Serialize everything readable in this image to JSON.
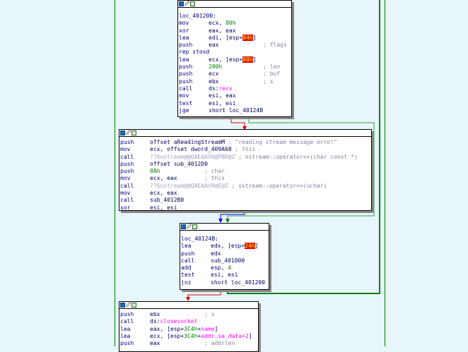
{
  "blocks": {
    "b1": {
      "label": "loc_401200:",
      "lines": [
        {
          "op": "mov",
          "args": [
            {
              "t": "ecx, "
            },
            {
              "t": "80h",
              "c": "n"
            }
          ]
        },
        {
          "op": "xor",
          "args": [
            {
              "t": "eax, eax"
            }
          ]
        },
        {
          "op": "lea",
          "args": [
            {
              "t": "edi, [esp+"
            },
            {
              "t": "84h",
              "c": "hl"
            },
            {
              "t": "]"
            }
          ]
        },
        {
          "op": "push",
          "args": [
            {
              "t": "eax             "
            },
            {
              "t": "; flags",
              "c": "cm"
            }
          ]
        },
        {
          "op": "rep stosd",
          "args": []
        },
        {
          "op": "lea",
          "args": [
            {
              "t": "ecx, [esp+"
            },
            {
              "t": "88h",
              "c": "hl"
            },
            {
              "t": "]"
            }
          ]
        },
        {
          "op": "push",
          "args": [
            {
              "t": "200h",
              "c": "n"
            },
            {
              "t": "            "
            },
            {
              "t": "; len",
              "c": "cm"
            }
          ]
        },
        {
          "op": "push",
          "args": [
            {
              "t": "ecx             "
            },
            {
              "t": "; buf",
              "c": "cm"
            }
          ]
        },
        {
          "op": "push",
          "args": [
            {
              "t": "ebx             "
            },
            {
              "t": "; s",
              "c": "cm"
            }
          ]
        },
        {
          "op": "call",
          "args": [
            {
              "t": "ds:"
            },
            {
              "t": "recv",
              "c": "fn"
            }
          ]
        },
        {
          "op": "mov",
          "args": [
            {
              "t": "esi, eax"
            }
          ]
        },
        {
          "op": "test",
          "args": [
            {
              "t": "esi, esi"
            }
          ]
        },
        {
          "op": "jge",
          "args": [
            {
              "t": "short loc_40124B"
            }
          ]
        }
      ]
    },
    "b2": {
      "lines": [
        {
          "op": "push",
          "args": [
            {
              "t": "offset aReadingStreamM "
            },
            {
              "t": "; \"reading stream message erro!\"",
              "c": "cm"
            }
          ]
        },
        {
          "op": "mov",
          "args": [
            {
              "t": "ecx, offset dword_409A68 "
            },
            {
              "t": "; this",
              "c": "cm"
            }
          ]
        },
        {
          "op": "call",
          "args": [
            {
              "t": "??6ostream@@QAEAAV0@PBD@Z",
              "c": "ex"
            },
            {
              "t": " "
            },
            {
              "t": "; ostream::operator<<(char const *)",
              "c": "cm"
            }
          ]
        },
        {
          "op": "push",
          "args": [
            {
              "t": "offset sub_4012D0"
            }
          ]
        },
        {
          "op": "push",
          "args": [
            {
              "t": "0Ah",
              "c": "n"
            },
            {
              "t": "             "
            },
            {
              "t": "; char",
              "c": "cm"
            }
          ]
        },
        {
          "op": "mov",
          "args": [
            {
              "t": "ecx, eax        "
            },
            {
              "t": "; this",
              "c": "cm"
            }
          ]
        },
        {
          "op": "call",
          "args": [
            {
              "t": "??6ostream@@QAEAAV0@E@Z",
              "c": "ex"
            },
            {
              "t": " "
            },
            {
              "t": "; ostream::operator<<(uchar)",
              "c": "cm"
            }
          ]
        },
        {
          "op": "mov",
          "args": [
            {
              "t": "ecx, eax"
            }
          ]
        },
        {
          "op": "call",
          "args": [
            {
              "t": "sub_4012B0"
            }
          ]
        },
        {
          "op": "xor",
          "args": [
            {
              "t": "esi, esi"
            }
          ]
        }
      ]
    },
    "b3": {
      "label": "loc_40124B:",
      "lines": [
        {
          "op": "lea",
          "args": [
            {
              "t": "edx, [esp+"
            },
            {
              "t": "24h",
              "c": "hl"
            },
            {
              "t": "]"
            }
          ]
        },
        {
          "op": "push",
          "args": [
            {
              "t": "edx"
            }
          ]
        },
        {
          "op": "call",
          "args": [
            {
              "t": "sub_401000"
            }
          ]
        },
        {
          "op": "add",
          "args": [
            {
              "t": "esp, "
            },
            {
              "t": "4",
              "c": "n"
            }
          ]
        },
        {
          "op": "test",
          "args": [
            {
              "t": "esi, esi"
            }
          ]
        },
        {
          "op": "jnz",
          "args": [
            {
              "t": "short loc_401200"
            }
          ]
        }
      ]
    },
    "b4": {
      "lines": [
        {
          "op": "push",
          "args": [
            {
              "t": "ebx             "
            },
            {
              "t": "; s",
              "c": "cm"
            }
          ]
        },
        {
          "op": "call",
          "args": [
            {
              "t": "ds:"
            },
            {
              "t": "closesocket",
              "c": "fn"
            }
          ]
        },
        {
          "op": "lea",
          "args": [
            {
              "t": "eax, [esp+"
            },
            {
              "t": "3C4h",
              "c": "n"
            },
            {
              "t": "+"
            },
            {
              "t": "name",
              "c": "fn"
            },
            {
              "t": "]"
            }
          ]
        },
        {
          "op": "lea",
          "args": [
            {
              "t": "ecx, [esp+"
            },
            {
              "t": "3C4h",
              "c": "n"
            },
            {
              "t": "+"
            },
            {
              "t": "addr.sa_data+2",
              "c": "fn"
            },
            {
              "t": "]"
            }
          ]
        },
        {
          "op": "push",
          "args": [
            {
              "t": "eax             "
            },
            {
              "t": "; addrlen",
              "c": "cm"
            }
          ]
        }
      ]
    }
  },
  "colors": {
    "edge_true": "#008000",
    "edge_false": "#e00000",
    "edge_uncond": "#0000ff",
    "edge_light": "#3aa03a"
  }
}
